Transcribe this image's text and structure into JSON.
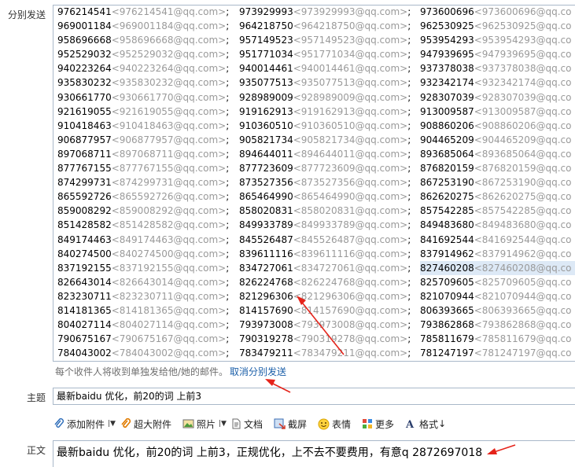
{
  "labels": {
    "recipients": "分别发送",
    "subject": "主题",
    "body": "正文"
  },
  "recipients": [
    [
      "976214541<976214541@qq.com>;",
      "973929993<973929993@qq.com>;",
      "973600696<973600696@qq.co"
    ],
    [
      "969001184<969001184@qq.com>;",
      "964218750<964218750@qq.com>;",
      "962530925<962530925@qq.co"
    ],
    [
      "958696668<958696668@qq.com>;",
      "957149523<957149523@qq.com>;",
      "953954293<953954293@qq.co"
    ],
    [
      "952529032<952529032@qq.com>;",
      "951771034<951771034@qq.com>;",
      "947939695<947939695@qq.co"
    ],
    [
      "940223264<940223264@qq.com>;",
      "940014461<940014461@qq.com>;",
      "937378038<937378038@qq.co"
    ],
    [
      "935830232<935830232@qq.com>;",
      "935077513<935077513@qq.com>;",
      "932342174<932342174@qq.co"
    ],
    [
      "930661770<930661770@qq.com>;",
      "928989009<928989009@qq.com>;",
      "928307039<928307039@qq.co"
    ],
    [
      "921619055<921619055@qq.com>;",
      "919162913<919162913@qq.com>;",
      "913009587<913009587@qq.co"
    ],
    [
      "910418463<910418463@qq.com>;",
      "910360510<910360510@qq.com>;",
      "908860206<908860206@qq.co"
    ],
    [
      "906877957<906877957@qq.com>;",
      "905821734<905821734@qq.com>;",
      "904465209<904465209@qq.co"
    ],
    [
      "897068711<897068711@qq.com>;",
      "894644011<894644011@qq.com>;",
      "893685064<893685064@qq.co"
    ],
    [
      "877767155<877767155@qq.com>;",
      "877723609<877723609@qq.com>;",
      "876820159<876820159@qq.co"
    ],
    [
      "874299731<874299731@qq.com>;",
      "873527356<873527356@qq.com>;",
      "867253190<867253190@qq.co"
    ],
    [
      "865592726<865592726@qq.com>;",
      "865464990<865464990@qq.com>;",
      "862620275<862620275@qq.co"
    ],
    [
      "859008292<859008292@qq.com>;",
      "858020831<858020831@qq.com>;",
      "857542285<857542285@qq.co"
    ],
    [
      "851428582<851428582@qq.com>;",
      "849933789<849933789@qq.com>;",
      "849483680<849483680@qq.co"
    ],
    [
      "849174463<849174463@qq.com>;",
      "845526487<845526487@qq.com>;",
      "841692544<841692544@qq.co"
    ],
    [
      "840274500<840274500@qq.com>;",
      "839611116<839611116@qq.com>;",
      "837914962<837914962@qq.co"
    ],
    [
      "837192155<837192155@qq.com>;",
      "834727061<834727061@qq.com>;",
      "827460208<827460208@qq.co"
    ],
    [
      "826643014<826643014@qq.com>;",
      "826224768<826224768@qq.com>;",
      "825709605<825709605@qq.co"
    ],
    [
      "823230711<823230711@qq.com>;",
      "821296306<821296306@qq.com>;",
      "821070944<821070944@qq.co"
    ],
    [
      "814181365<814181365@qq.com>;",
      "814157690<814157690@qq.com>;",
      "806393665<806393665@qq.co"
    ],
    [
      "804027114<804027114@qq.com>;",
      "793973008<793973008@qq.com>;",
      "793862868<793862868@qq.co"
    ],
    [
      "790675167<790675167@qq.com>;",
      "790319278<790319278@qq.com>;",
      "785811679<785811679@qq.co"
    ],
    [
      "784043002<784043002@qq.com>;",
      "783479211<783479211@qq.com>;",
      "781247197<781247197@qq.co"
    ]
  ],
  "selected_recipient": {
    "row": 18,
    "col": 2
  },
  "note": {
    "text": "每个收件人将收到单独发给他/她的邮件。",
    "link": "取消分别发送"
  },
  "subject": "最新baidu 优化，前20的词 上前3",
  "toolbar": [
    {
      "icon": "paperclip-icon",
      "label": "添加附件",
      "dropdown": true
    },
    {
      "icon": "large-attachment-icon",
      "label": "超大附件",
      "dropdown": false
    },
    {
      "icon": "photo-icon",
      "label": "照片",
      "dropdown": true
    },
    {
      "icon": "document-icon",
      "label": "文档",
      "dropdown": false
    },
    {
      "icon": "screenshot-icon",
      "label": "截屏",
      "dropdown": false
    },
    {
      "icon": "emoticon-icon",
      "label": "表情",
      "dropdown": false
    },
    {
      "icon": "more-icon",
      "label": "更多",
      "dropdown": false
    },
    {
      "icon": "format-icon",
      "label": "格式",
      "dropdown": false,
      "suffix": "↓"
    }
  ],
  "body_text": "最新baidu 优化，前20的词 上前3，正规优化，上不去不要费用，有意q  2872697018",
  "colors": {
    "border": "#a9b8c9",
    "link": "#1a5ea8",
    "email": "#9a9a9a",
    "annotation": "#e5231a",
    "selection": "#dde9f6"
  }
}
